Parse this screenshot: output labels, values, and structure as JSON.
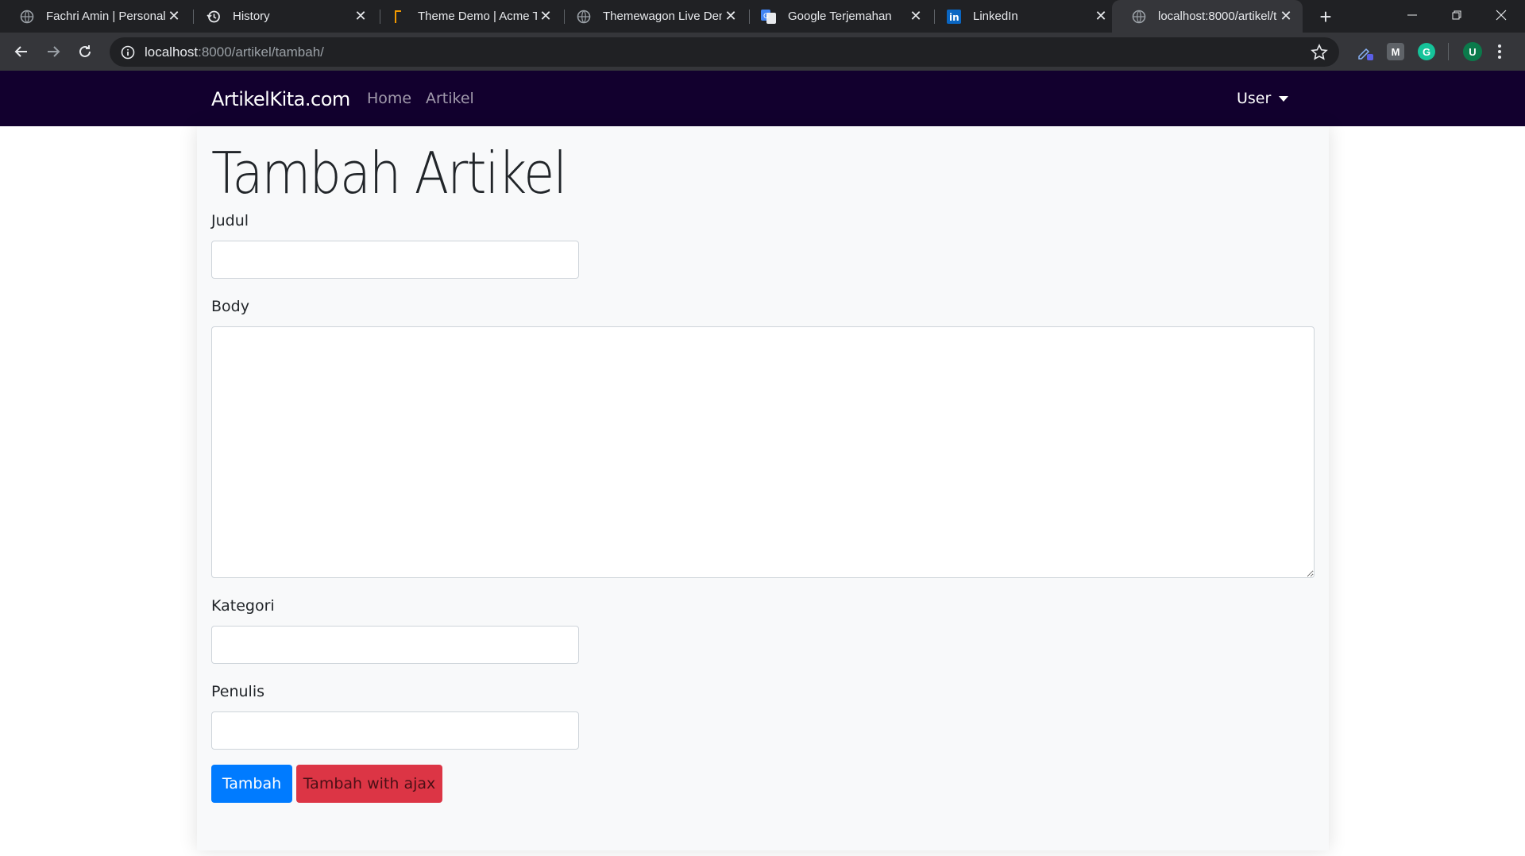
{
  "browser": {
    "tabs": [
      {
        "title": "Fachri Amin | Personal P",
        "icon": "globe-icon",
        "active": false
      },
      {
        "title": "History",
        "icon": "history-icon",
        "active": false
      },
      {
        "title": "Theme Demo | Acme Th",
        "icon": "theme-bracket-icon",
        "active": false
      },
      {
        "title": "Themewagon Live Dem",
        "icon": "globe-icon",
        "active": false
      },
      {
        "title": "Google Terjemahan",
        "icon": "google-translate-icon",
        "active": false
      },
      {
        "title": "LinkedIn",
        "icon": "linkedin-icon",
        "active": false
      },
      {
        "title": "localhost:8000/artikel/t",
        "icon": "globe-icon",
        "active": true
      }
    ],
    "url_host": "localhost",
    "url_rest": ":8000/artikel/tambah/",
    "profile_initial": "U",
    "ext_m_label": "M",
    "ext_g_label": "G",
    "colors": {
      "tabstrip": "#202124",
      "toolbar": "#35363a",
      "omnibox": "#202124"
    }
  },
  "navbar": {
    "brand": "ArtikelKita.com",
    "links": [
      "Home",
      "Artikel"
    ],
    "user_label": "User",
    "background": "#12002e"
  },
  "form": {
    "title": "Tambah Artikel",
    "fields": {
      "judul_label": "Judul",
      "judul_value": "",
      "body_label": "Body",
      "body_value": "",
      "kategori_label": "Kategori",
      "kategori_value": "",
      "penulis_label": "Penulis",
      "penulis_value": ""
    },
    "submit_label": "Tambah",
    "ajax_label": "Tambah with ajax"
  }
}
